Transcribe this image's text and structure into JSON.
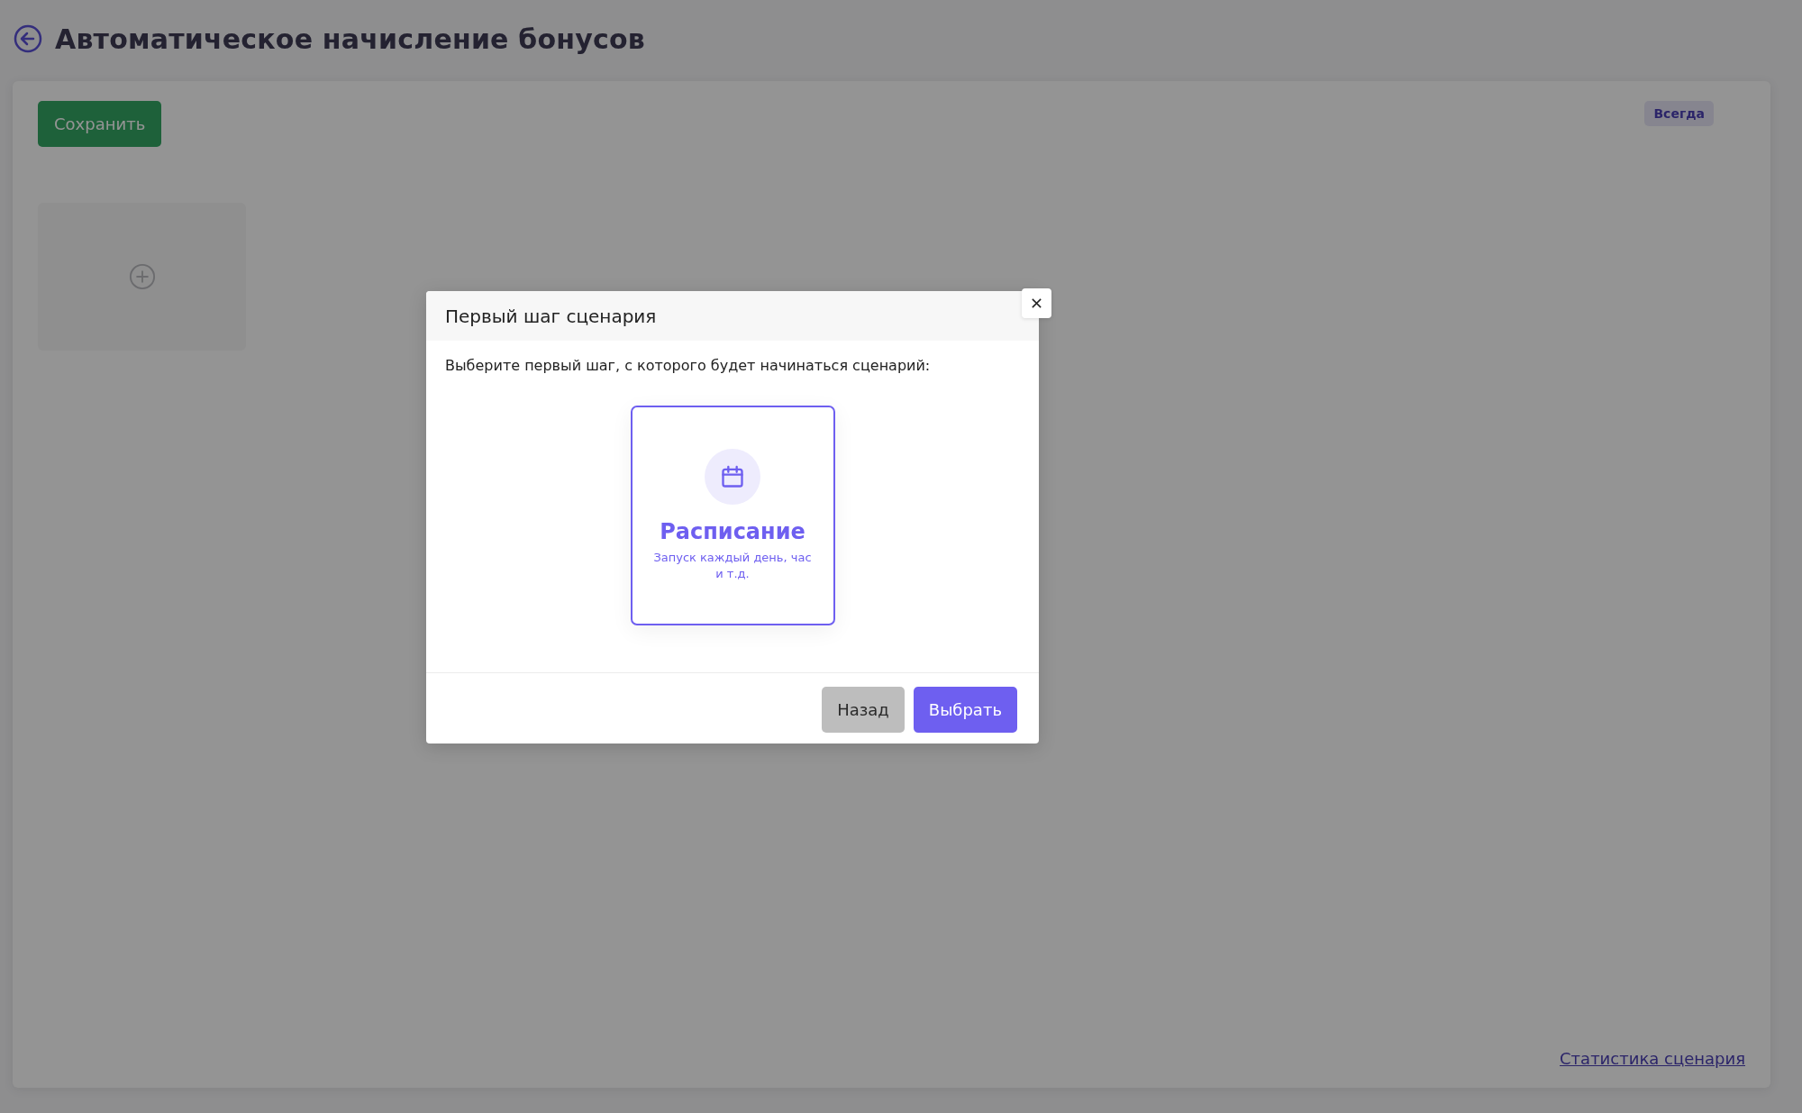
{
  "page": {
    "title": "Автоматическое начисление бонусов"
  },
  "toolbar": {
    "save_button": "Сохранить",
    "badge": "Всегда"
  },
  "footer_link": "Статистика сценария",
  "modal": {
    "title": "Первый шаг сценария",
    "prompt": "Выберите первый шаг, с которого будет начинаться сценарий:",
    "options": [
      {
        "title": "Расписание",
        "description": "Запуск каждый день, час и т.д.",
        "selected": true
      }
    ],
    "buttons": [
      {
        "label": "Назад",
        "kind": "secondary"
      },
      {
        "label": "Выбрать",
        "kind": "primary"
      }
    ]
  }
}
